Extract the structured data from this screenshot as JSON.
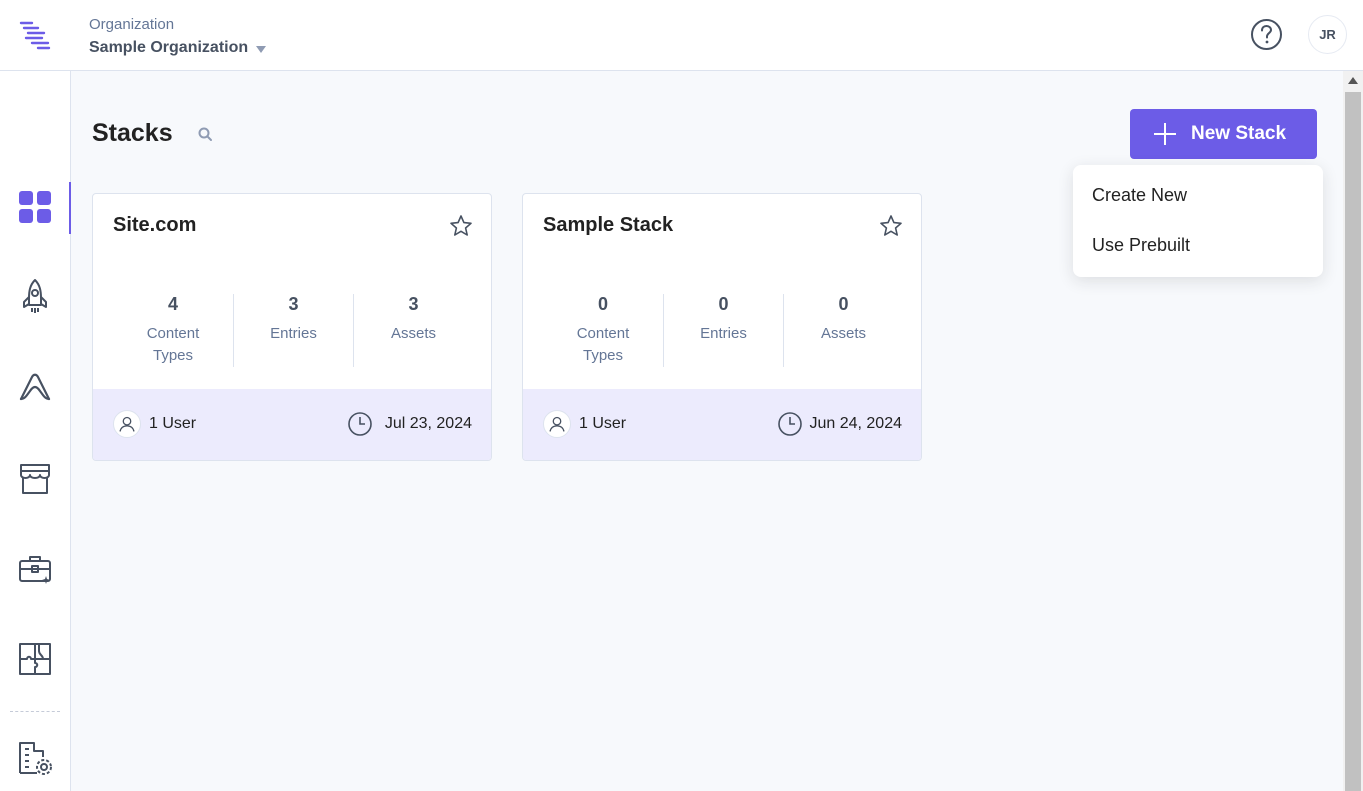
{
  "header": {
    "org_label": "Organization",
    "org_name": "Sample Organization",
    "avatar_initials": "JR",
    "help_icon": "question-circle-icon",
    "logo_icon": "brand-logo-icon"
  },
  "sidebar": {
    "items": [
      {
        "name": "stacks",
        "icon": "grid-icon",
        "active": true
      },
      {
        "name": "launch",
        "icon": "rocket-icon",
        "active": false
      },
      {
        "name": "automate",
        "icon": "automate-icon",
        "active": false
      },
      {
        "name": "marketplace",
        "icon": "store-icon",
        "active": false
      },
      {
        "name": "developer-hub",
        "icon": "toolbox-icon",
        "active": false
      },
      {
        "name": "extensions",
        "icon": "puzzle-icon",
        "active": false
      },
      {
        "name": "org-settings",
        "icon": "building-settings-icon",
        "active": false
      }
    ]
  },
  "main": {
    "title": "Stacks",
    "new_stack_label": "New Stack",
    "dropdown": [
      "Create New",
      "Use Prebuilt"
    ],
    "stacks": [
      {
        "name": "Site.com",
        "stats": [
          {
            "value": "4",
            "label": "Content Types"
          },
          {
            "value": "3",
            "label": "Entries"
          },
          {
            "value": "3",
            "label": "Assets"
          }
        ],
        "users": "1 User",
        "date": "Jul 23, 2024"
      },
      {
        "name": "Sample Stack",
        "stats": [
          {
            "value": "0",
            "label": "Content Types"
          },
          {
            "value": "0",
            "label": "Entries"
          },
          {
            "value": "0",
            "label": "Assets"
          }
        ],
        "users": "1 User",
        "date": "Jun 24, 2024"
      }
    ]
  },
  "colors": {
    "accent": "#6c5ce7",
    "card_footer": "#ecebfd",
    "main_bg": "#f7f9fc",
    "icon_gray": "#475161"
  }
}
